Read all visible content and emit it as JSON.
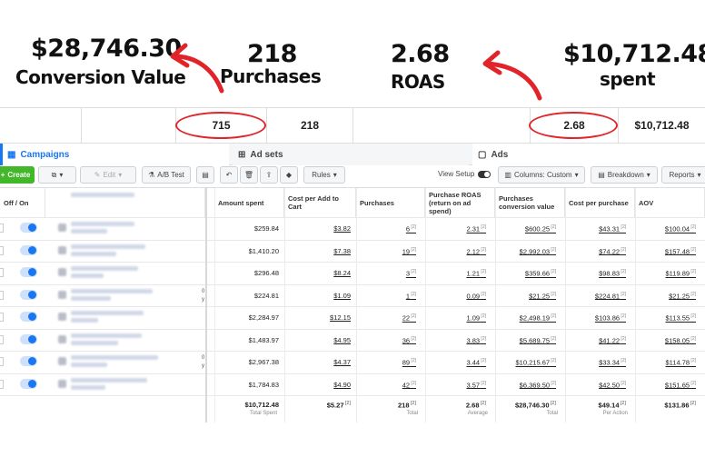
{
  "annotations": {
    "conversion_value_amount": "$28,746.30",
    "conversion_value_label": "Conversion Value",
    "purchases_amount": "218",
    "purchases_label": "Purchases",
    "roas_amount": "2.68",
    "roas_label": "ROAS",
    "spent_amount": "$10,712.48",
    "spent_label": "spent"
  },
  "summary": {
    "circled_left": "715",
    "purchases": "218",
    "roas": "2.68",
    "spent": "$10,712.48"
  },
  "tabs": {
    "campaigns": "Campaigns",
    "ad_sets": "Ad sets",
    "ads": "Ads"
  },
  "toolbar": {
    "create": "Create",
    "edit": "Edit",
    "ab_test": "A/B Test",
    "rules": "Rules",
    "view_setup": "View Setup",
    "columns": "Columns: Custom",
    "breakdown": "Breakdown",
    "reports": "Reports"
  },
  "table": {
    "offon_header": "Off / On",
    "headers": [
      "Amount spent",
      "Cost per Add to Cart",
      "Purchases",
      "Purchase ROAS (return on ad spend)",
      "Purchases conversion value",
      "Cost per purchase",
      "AOV"
    ],
    "rows": [
      [
        "$259.84",
        "$3.82",
        "6",
        "2.31",
        "$600.25",
        "$43.31",
        "$100.04"
      ],
      [
        "$1,410.20",
        "$7.38",
        "19",
        "2.12",
        "$2,992.03",
        "$74.22",
        "$157.48"
      ],
      [
        "$296.48",
        "$8.24",
        "3",
        "1.21",
        "$359.66",
        "$98.83",
        "$119.89"
      ],
      [
        "$224.81",
        "$1.09",
        "1",
        "0.09",
        "$21.25",
        "$224.81",
        "$21.25"
      ],
      [
        "$2,284.97",
        "$12.15",
        "22",
        "1.09",
        "$2,498.19",
        "$103.86",
        "$113.55"
      ],
      [
        "$1,483.97",
        "$4.95",
        "36",
        "3.83",
        "$5,689.75",
        "$41.22",
        "$158.05"
      ],
      [
        "$2,967.38",
        "$4.37",
        "89",
        "3.44",
        "$10,215.67",
        "$33.34",
        "$114.78"
      ],
      [
        "$1,784.83",
        "$4.90",
        "42",
        "3.57",
        "$6,369.50",
        "$42.50",
        "$151.65"
      ]
    ],
    "totals": [
      "$10,712.48",
      "$5.27",
      "218",
      "2.68",
      "$28,746.30",
      "$49.14",
      "$131.86"
    ],
    "total_labels": [
      "Total Spent",
      "",
      "Total",
      "Average",
      "Total",
      "Per Action",
      ""
    ],
    "stray_digits": [
      "0",
      "y",
      "0",
      "y"
    ]
  },
  "colors": {
    "accent": "#1877f2",
    "create_green": "#42b72a",
    "annotation_red": "#e0242a"
  }
}
